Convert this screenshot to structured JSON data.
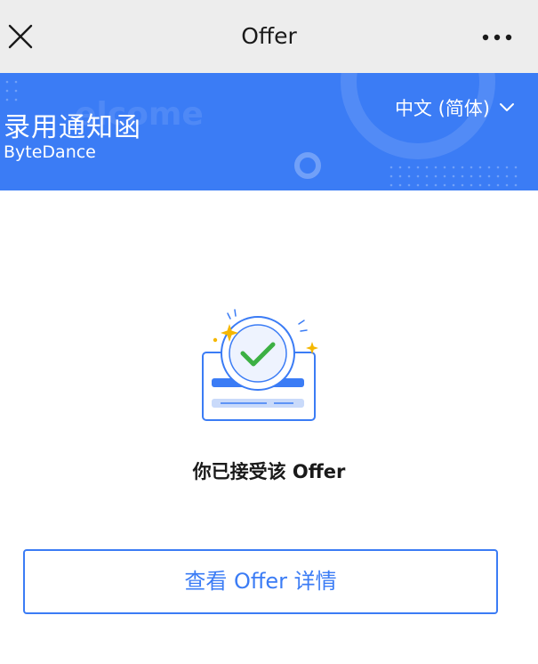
{
  "topbar": {
    "title": "Offer"
  },
  "banner": {
    "heading": "录用通知函",
    "company": "ByteDance",
    "language": "中文 (简体)"
  },
  "main": {
    "status_text": "你已接受该 Offer",
    "view_button_label": "查看 Offer 详情"
  },
  "icons": {
    "close": "close-icon",
    "more": "more-dots-icon",
    "language": "chevron-down-icon",
    "illustration": "check-badge-icon"
  },
  "colors": {
    "accent": "#3b7cf5",
    "topbar_bg": "#ededed",
    "check": "#3cb043",
    "sparkle": "#f5b700"
  }
}
